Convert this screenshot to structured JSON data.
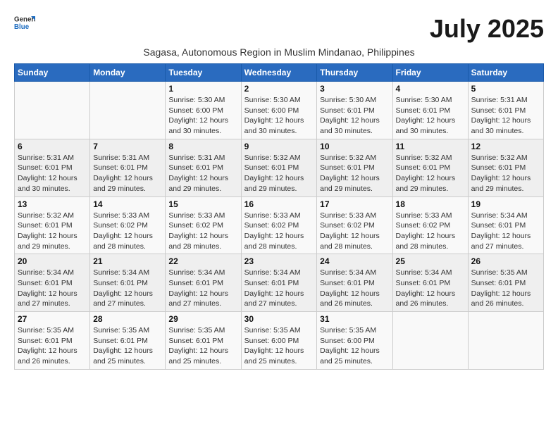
{
  "header": {
    "logo_general": "General",
    "logo_blue": "Blue",
    "month_title": "July 2025",
    "subtitle": "Sagasa, Autonomous Region in Muslim Mindanao, Philippines"
  },
  "days_of_week": [
    "Sunday",
    "Monday",
    "Tuesday",
    "Wednesday",
    "Thursday",
    "Friday",
    "Saturday"
  ],
  "weeks": [
    [
      {
        "day": "",
        "detail": ""
      },
      {
        "day": "",
        "detail": ""
      },
      {
        "day": "1",
        "detail": "Sunrise: 5:30 AM\nSunset: 6:00 PM\nDaylight: 12 hours and 30 minutes."
      },
      {
        "day": "2",
        "detail": "Sunrise: 5:30 AM\nSunset: 6:00 PM\nDaylight: 12 hours and 30 minutes."
      },
      {
        "day": "3",
        "detail": "Sunrise: 5:30 AM\nSunset: 6:01 PM\nDaylight: 12 hours and 30 minutes."
      },
      {
        "day": "4",
        "detail": "Sunrise: 5:30 AM\nSunset: 6:01 PM\nDaylight: 12 hours and 30 minutes."
      },
      {
        "day": "5",
        "detail": "Sunrise: 5:31 AM\nSunset: 6:01 PM\nDaylight: 12 hours and 30 minutes."
      }
    ],
    [
      {
        "day": "6",
        "detail": "Sunrise: 5:31 AM\nSunset: 6:01 PM\nDaylight: 12 hours and 30 minutes."
      },
      {
        "day": "7",
        "detail": "Sunrise: 5:31 AM\nSunset: 6:01 PM\nDaylight: 12 hours and 29 minutes."
      },
      {
        "day": "8",
        "detail": "Sunrise: 5:31 AM\nSunset: 6:01 PM\nDaylight: 12 hours and 29 minutes."
      },
      {
        "day": "9",
        "detail": "Sunrise: 5:32 AM\nSunset: 6:01 PM\nDaylight: 12 hours and 29 minutes."
      },
      {
        "day": "10",
        "detail": "Sunrise: 5:32 AM\nSunset: 6:01 PM\nDaylight: 12 hours and 29 minutes."
      },
      {
        "day": "11",
        "detail": "Sunrise: 5:32 AM\nSunset: 6:01 PM\nDaylight: 12 hours and 29 minutes."
      },
      {
        "day": "12",
        "detail": "Sunrise: 5:32 AM\nSunset: 6:01 PM\nDaylight: 12 hours and 29 minutes."
      }
    ],
    [
      {
        "day": "13",
        "detail": "Sunrise: 5:32 AM\nSunset: 6:01 PM\nDaylight: 12 hours and 29 minutes."
      },
      {
        "day": "14",
        "detail": "Sunrise: 5:33 AM\nSunset: 6:02 PM\nDaylight: 12 hours and 28 minutes."
      },
      {
        "day": "15",
        "detail": "Sunrise: 5:33 AM\nSunset: 6:02 PM\nDaylight: 12 hours and 28 minutes."
      },
      {
        "day": "16",
        "detail": "Sunrise: 5:33 AM\nSunset: 6:02 PM\nDaylight: 12 hours and 28 minutes."
      },
      {
        "day": "17",
        "detail": "Sunrise: 5:33 AM\nSunset: 6:02 PM\nDaylight: 12 hours and 28 minutes."
      },
      {
        "day": "18",
        "detail": "Sunrise: 5:33 AM\nSunset: 6:02 PM\nDaylight: 12 hours and 28 minutes."
      },
      {
        "day": "19",
        "detail": "Sunrise: 5:34 AM\nSunset: 6:01 PM\nDaylight: 12 hours and 27 minutes."
      }
    ],
    [
      {
        "day": "20",
        "detail": "Sunrise: 5:34 AM\nSunset: 6:01 PM\nDaylight: 12 hours and 27 minutes."
      },
      {
        "day": "21",
        "detail": "Sunrise: 5:34 AM\nSunset: 6:01 PM\nDaylight: 12 hours and 27 minutes."
      },
      {
        "day": "22",
        "detail": "Sunrise: 5:34 AM\nSunset: 6:01 PM\nDaylight: 12 hours and 27 minutes."
      },
      {
        "day": "23",
        "detail": "Sunrise: 5:34 AM\nSunset: 6:01 PM\nDaylight: 12 hours and 27 minutes."
      },
      {
        "day": "24",
        "detail": "Sunrise: 5:34 AM\nSunset: 6:01 PM\nDaylight: 12 hours and 26 minutes."
      },
      {
        "day": "25",
        "detail": "Sunrise: 5:34 AM\nSunset: 6:01 PM\nDaylight: 12 hours and 26 minutes."
      },
      {
        "day": "26",
        "detail": "Sunrise: 5:35 AM\nSunset: 6:01 PM\nDaylight: 12 hours and 26 minutes."
      }
    ],
    [
      {
        "day": "27",
        "detail": "Sunrise: 5:35 AM\nSunset: 6:01 PM\nDaylight: 12 hours and 26 minutes."
      },
      {
        "day": "28",
        "detail": "Sunrise: 5:35 AM\nSunset: 6:01 PM\nDaylight: 12 hours and 25 minutes."
      },
      {
        "day": "29",
        "detail": "Sunrise: 5:35 AM\nSunset: 6:01 PM\nDaylight: 12 hours and 25 minutes."
      },
      {
        "day": "30",
        "detail": "Sunrise: 5:35 AM\nSunset: 6:00 PM\nDaylight: 12 hours and 25 minutes."
      },
      {
        "day": "31",
        "detail": "Sunrise: 5:35 AM\nSunset: 6:00 PM\nDaylight: 12 hours and 25 minutes."
      },
      {
        "day": "",
        "detail": ""
      },
      {
        "day": "",
        "detail": ""
      }
    ]
  ]
}
